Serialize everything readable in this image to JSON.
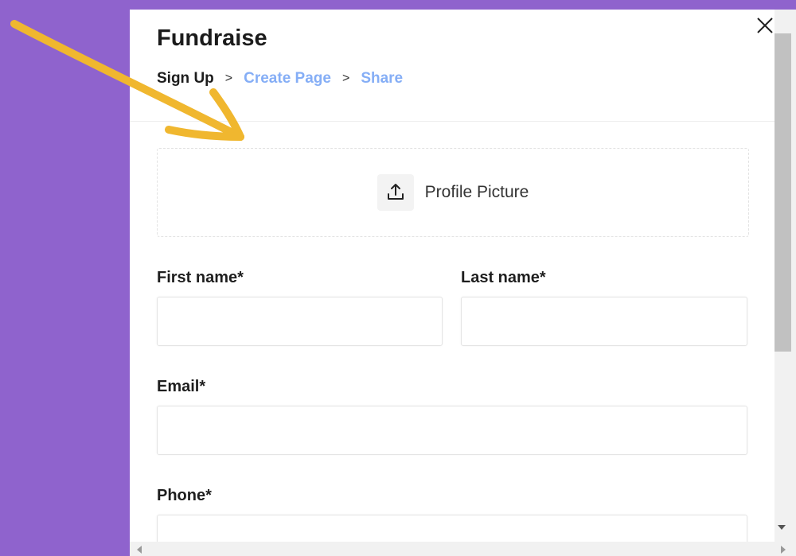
{
  "dialog": {
    "title": "Fundraise",
    "breadcrumb": {
      "step1": "Sign Up",
      "step2": "Create Page",
      "step3": "Share",
      "separator": ">"
    },
    "close_icon": "close-icon"
  },
  "upload": {
    "icon": "upload-icon",
    "label": "Profile Picture"
  },
  "form": {
    "first_name_label": "First name*",
    "last_name_label": "Last name*",
    "email_label": "Email*",
    "phone_label": "Phone*",
    "first_name_value": "",
    "last_name_value": "",
    "email_value": "",
    "phone_value": ""
  },
  "colors": {
    "background": "#8f63cd",
    "link": "#85aef6",
    "annotation_arrow": "#f0b72f"
  }
}
